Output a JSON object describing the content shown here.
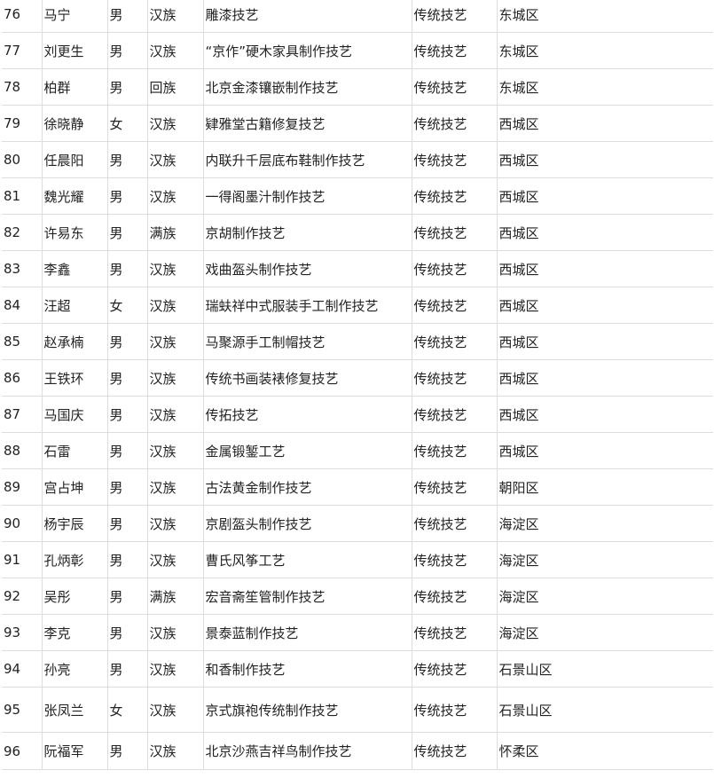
{
  "rows": [
    {
      "no": "76",
      "name": "马宁",
      "gender": "男",
      "ethnicity": "汉族",
      "item": "雕漆技艺",
      "category": "传统技艺",
      "district": "东城区"
    },
    {
      "no": "77",
      "name": "刘更生",
      "gender": "男",
      "ethnicity": "汉族",
      "item": "“京作”硬木家具制作技艺",
      "category": "传统技艺",
      "district": "东城区"
    },
    {
      "no": "78",
      "name": "柏群",
      "gender": "男",
      "ethnicity": "回族",
      "item": "北京金漆镶嵌制作技艺",
      "category": "传统技艺",
      "district": "东城区"
    },
    {
      "no": "79",
      "name": "徐晓静",
      "gender": "女",
      "ethnicity": "汉族",
      "item": "肄雅堂古籍修复技艺",
      "category": "传统技艺",
      "district": "西城区"
    },
    {
      "no": "80",
      "name": "任晨阳",
      "gender": "男",
      "ethnicity": "汉族",
      "item": "内联升千层底布鞋制作技艺",
      "category": "传统技艺",
      "district": "西城区"
    },
    {
      "no": "81",
      "name": "魏光耀",
      "gender": "男",
      "ethnicity": "汉族",
      "item": "一得阁墨汁制作技艺",
      "category": "传统技艺",
      "district": "西城区"
    },
    {
      "no": "82",
      "name": "许易东",
      "gender": "男",
      "ethnicity": "满族",
      "item": "京胡制作技艺",
      "category": "传统技艺",
      "district": "西城区"
    },
    {
      "no": "83",
      "name": "李鑫",
      "gender": "男",
      "ethnicity": "汉族",
      "item": "戏曲盔头制作技艺",
      "category": "传统技艺",
      "district": "西城区"
    },
    {
      "no": "84",
      "name": "汪超",
      "gender": "女",
      "ethnicity": "汉族",
      "item": "瑞蚨祥中式服装手工制作技艺",
      "category": "传统技艺",
      "district": "西城区"
    },
    {
      "no": "85",
      "name": "赵承楠",
      "gender": "男",
      "ethnicity": "汉族",
      "item": "马聚源手工制帽技艺",
      "category": "传统技艺",
      "district": "西城区"
    },
    {
      "no": "86",
      "name": "王铁环",
      "gender": "男",
      "ethnicity": "汉族",
      "item": "传统书画装裱修复技艺",
      "category": "传统技艺",
      "district": "西城区"
    },
    {
      "no": "87",
      "name": "马国庆",
      "gender": "男",
      "ethnicity": "汉族",
      "item": "传拓技艺",
      "category": "传统技艺",
      "district": "西城区"
    },
    {
      "no": "88",
      "name": "石雷",
      "gender": "男",
      "ethnicity": "汉族",
      "item": "金属锻錾工艺",
      "category": "传统技艺",
      "district": "西城区"
    },
    {
      "no": "89",
      "name": "宫占坤",
      "gender": "男",
      "ethnicity": "汉族",
      "item": "古法黄金制作技艺",
      "category": "传统技艺",
      "district": "朝阳区"
    },
    {
      "no": "90",
      "name": "杨宇辰",
      "gender": "男",
      "ethnicity": "汉族",
      "item": "京剧盔头制作技艺",
      "category": "传统技艺",
      "district": "海淀区"
    },
    {
      "no": "91",
      "name": "孔炳彰",
      "gender": "男",
      "ethnicity": "汉族",
      "item": "曹氏风筝工艺",
      "category": "传统技艺",
      "district": "海淀区"
    },
    {
      "no": "92",
      "name": "吴彤",
      "gender": "男",
      "ethnicity": "满族",
      "item": "宏音斋笙管制作技艺",
      "category": "传统技艺",
      "district": "海淀区"
    },
    {
      "no": "93",
      "name": "李克",
      "gender": "男",
      "ethnicity": "汉族",
      "item": "景泰蓝制作技艺",
      "category": "传统技艺",
      "district": "海淀区"
    },
    {
      "no": "94",
      "name": "孙亮",
      "gender": "男",
      "ethnicity": "汉族",
      "item": "和香制作技艺",
      "category": "传统技艺",
      "district": "石景山区"
    },
    {
      "no": "95",
      "name": "张凤兰",
      "gender": "女",
      "ethnicity": "汉族",
      "item": "京式旗袍传统制作技艺",
      "category": "传统技艺",
      "district": "石景山区"
    },
    {
      "no": "96",
      "name": "阮福军",
      "gender": "男",
      "ethnicity": "汉族",
      "item": "北京沙燕吉祥鸟制作技艺",
      "category": "传统技艺",
      "district": "怀柔区"
    }
  ]
}
